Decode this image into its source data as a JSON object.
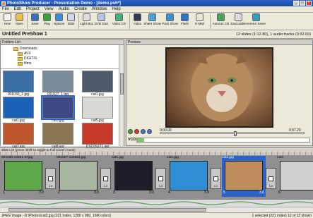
{
  "window": {
    "title": "PhotoShow Producer - Presentation Demo - [demo.psh*]"
  },
  "menu": [
    "File",
    "Edit",
    "Project",
    "View",
    "Audio",
    "Create",
    "Window",
    "Help"
  ],
  "toolbar": {
    "buttons": [
      {
        "label": "New",
        "color": "#f3f3f3"
      },
      {
        "label": "Open",
        "color": "#e7c24a"
      },
      {
        "label": "Save",
        "color": "#3b6fbf"
      },
      {
        "label": "Play",
        "color": "#3ca33c"
      },
      {
        "label": "Options",
        "color": "#3a8bd8"
      },
      {
        "label": "Slide",
        "color": "#cfd8e6"
      },
      {
        "label": "Light Box",
        "color": "#ddd"
      },
      {
        "label": "DVD Disc",
        "color": "#b7c6e0"
      },
      {
        "label": "Video CD",
        "color": "#3fb27a"
      },
      {
        "label": "Video",
        "color": "#2f3b56"
      },
      {
        "label": "Share Show",
        "color": "#46a0d6"
      },
      {
        "label": "Pack Show",
        "color": "#3f8ccf"
      },
      {
        "label": "Flash",
        "color": "#2d74c2"
      },
      {
        "label": "E-Mail",
        "color": "#e9e4d0"
      },
      {
        "label": "Autorun CD",
        "color": "#47a556"
      },
      {
        "label": "Executable",
        "color": "#d9d9d9"
      },
      {
        "label": "Screen Saver",
        "color": "#2fa0b8"
      }
    ]
  },
  "project": {
    "title": "Untitled PreShow 1",
    "info": "12 slides (1:12.80), 1 audio tracks (0:32.00)"
  },
  "left_pane": {
    "header": "Folders List",
    "tree": [
      {
        "label": "Downloads"
      },
      {
        "label": "AVX"
      },
      {
        "label": "DIGITIS"
      },
      {
        "label": "filmo"
      }
    ],
    "thumbs": [
      {
        "caption": "001030_1.jpg",
        "color": "#3a6fa6",
        "selected": false
      },
      {
        "caption": "001027_1.jpg",
        "color": "#7a8b9a",
        "selected": false
      },
      {
        "caption": "cat1.jpg",
        "color": "#4c5a6a",
        "selected": false
      },
      {
        "caption": "cat1.jpg",
        "color": "#1b63b8",
        "selected": false
      },
      {
        "caption": "cat3.jpg",
        "color": "#3d4a86",
        "selected": true
      },
      {
        "caption": "cat5.jpg",
        "color": "#dad8d2",
        "selected": false
      },
      {
        "caption": "cat7.jpg",
        "color": "#c0562d",
        "selected": false
      },
      {
        "caption": "cat8.jpg",
        "color": "#8a7752",
        "selected": false
      },
      {
        "caption": "DSC05271.jpg",
        "color": "#c73a2a",
        "selected": false
      }
    ]
  },
  "right_pane": {
    "header": "Preview",
    "time_start": "0:00.00",
    "time_end": "0:07.20",
    "seek_fraction": 0.52,
    "vcd_label": "VCD",
    "vcd_fill_fraction": 0.04
  },
  "slide_list": {
    "header": "Slide List (press 'Shift' to toggle to Full screen mode)",
    "slides": [
      {
        "caption": "001030-13451-37jpg",
        "num": "1",
        "dur": "3.0",
        "color": "#5fa84a",
        "selected": false
      },
      {
        "caption": "001027-134622.jpg",
        "num": "2",
        "dur": "3.0",
        "color": "#a9b7a0",
        "selected": false
      },
      {
        "caption": "cat1.jpg",
        "num": "3",
        "dur": "3.0",
        "color": "#1c1d28",
        "selected": false
      },
      {
        "caption": "cat1.jpg",
        "num": "4",
        "dur": "3.0",
        "color": "#2f8fd6",
        "selected": false
      },
      {
        "caption": "cat3.jpg",
        "num": "5",
        "dur": "3.0",
        "color": "#bf8c5c",
        "selected": true
      },
      {
        "caption": "cat4",
        "num": "6",
        "dur": "",
        "color": "#cfcfcf",
        "selected": false
      }
    ],
    "transitions": [
      {
        "dur": "1.0"
      },
      {
        "dur": "1.0"
      },
      {
        "dur": "1.0"
      },
      {
        "dur": "1.0"
      },
      {
        "dur": "1.0"
      }
    ]
  },
  "status": {
    "left": "JPEG Image - D:\\Photos\\cat3.jpg (221 Index, 1280 x 960, 16M colors)",
    "right": "1 selected (221 index) 12 of 13 shown"
  }
}
